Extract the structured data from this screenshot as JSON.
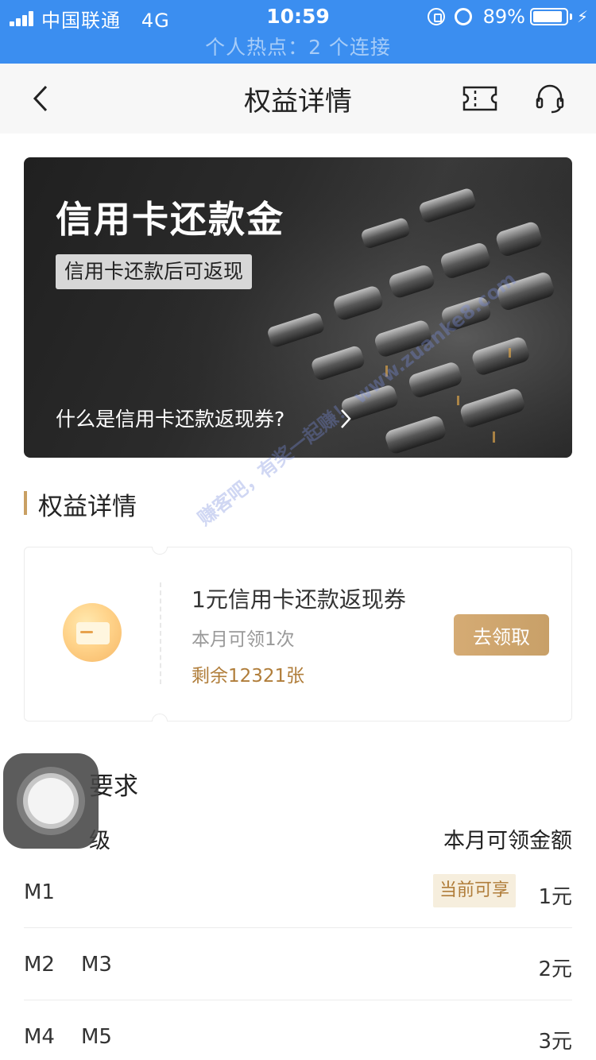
{
  "status_bar": {
    "carrier": "中国联通",
    "network": "4G",
    "time": "10:59",
    "battery": "89%",
    "battery_level": 0.89,
    "hotspot": "个人热点：2 个连接"
  },
  "nav": {
    "title": "权益详情",
    "back_icon": "chevron-left-icon",
    "ticket_icon": "ticket-icon",
    "service_icon": "headset-icon"
  },
  "banner": {
    "title": "信用卡还款金",
    "tag": "信用卡还款后可返现",
    "link": "什么是信用卡还款返现券?",
    "link_icon": "chevron-right-icon"
  },
  "details_section": {
    "title": "权益详情"
  },
  "voucher": {
    "name": "1元信用卡还款返现券",
    "limit": "本月可领1次",
    "remaining": "剩余12321张",
    "claim_button": "去领取",
    "icon": "credit-card-icon"
  },
  "requirements_section": {
    "title": "要求"
  },
  "level_table": {
    "header_left": "级",
    "header_right": "本月可领金额",
    "rows": [
      {
        "levels": [
          "M1"
        ],
        "badge": "当前可享",
        "amount": "1元"
      },
      {
        "levels": [
          "M2",
          "M3"
        ],
        "badge": "",
        "amount": "2元"
      },
      {
        "levels": [
          "M4",
          "M5"
        ],
        "badge": "",
        "amount": "3元"
      }
    ]
  },
  "watermark": "赚客吧，有奖一起赚！ www.zuanke8.com",
  "colors": {
    "status_bar_bg": "#3b8ef0",
    "accent_gold": "#c9a063",
    "claim_button": "#d0a66e",
    "badge_bg": "#f6eedd"
  }
}
